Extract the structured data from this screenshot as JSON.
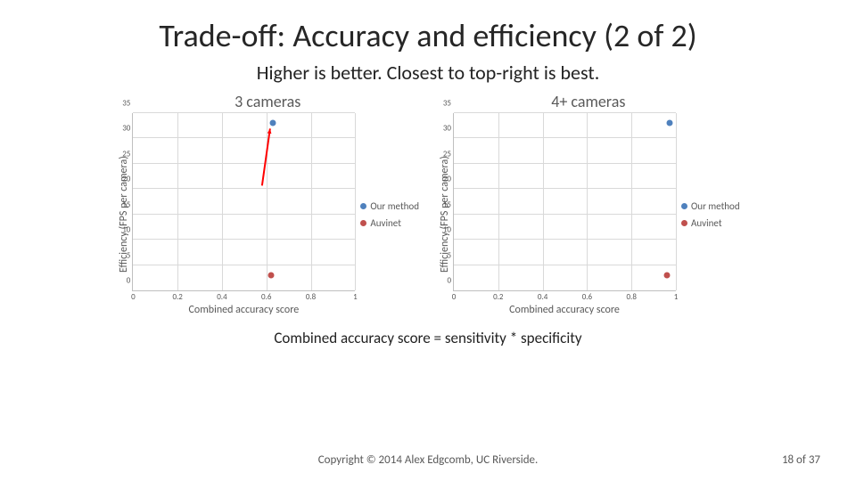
{
  "title": "Trade-off: Accuracy and efficiency (2 of 2)",
  "subtitle": "Higher is better. Closest to top-right is best.",
  "formula": "Combined accuracy score = sensitivity * specificity",
  "copyright": "Copyright © 2014 Alex Edgcomb, UC Riverside.",
  "pagenum": "18 of 37",
  "colors": {
    "our": "#4F81BD",
    "auvinet": "#C0504D",
    "arrow": "#FF0000"
  },
  "chart_data": [
    {
      "title": "3 cameras",
      "type": "scatter",
      "xlabel": "Combined accuracy score",
      "ylabel": "Efficiency (FPS per camera)",
      "xlim": [
        0,
        1
      ],
      "ylim": [
        0,
        35
      ],
      "xticks": [
        0,
        0.2,
        0.4,
        0.6,
        0.8,
        1
      ],
      "yticks": [
        0,
        5,
        10,
        15,
        20,
        25,
        30,
        35
      ],
      "series": [
        {
          "name": "Our method",
          "color_key": "our",
          "points": [
            {
              "x": 0.63,
              "y": 33
            }
          ]
        },
        {
          "name": "Auvinet",
          "color_key": "auvinet",
          "points": [
            {
              "x": 0.62,
              "y": 3
            }
          ]
        }
      ],
      "has_arrow": true
    },
    {
      "title": "4+ cameras",
      "type": "scatter",
      "xlabel": "Combined accuracy score",
      "ylabel": "Efficiency (FPS per camera)",
      "xlim": [
        0,
        1
      ],
      "ylim": [
        0,
        35
      ],
      "xticks": [
        0,
        0.2,
        0.4,
        0.6,
        0.8,
        1
      ],
      "yticks": [
        0,
        5,
        10,
        15,
        20,
        25,
        30,
        35
      ],
      "series": [
        {
          "name": "Our method",
          "color_key": "our",
          "points": [
            {
              "x": 0.97,
              "y": 33
            }
          ]
        },
        {
          "name": "Auvinet",
          "color_key": "auvinet",
          "points": [
            {
              "x": 0.96,
              "y": 3
            }
          ]
        }
      ],
      "has_arrow": false
    }
  ]
}
